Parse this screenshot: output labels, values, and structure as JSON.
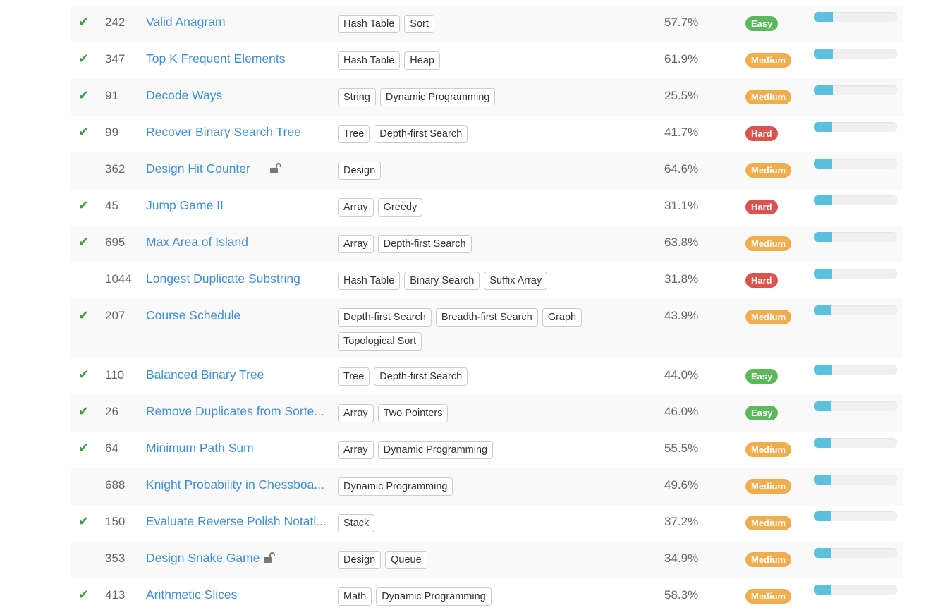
{
  "colors": {
    "easy": "#5cb85c",
    "medium": "#f0ad4e",
    "hard": "#d9534f",
    "check": "#3c9a48",
    "link": "#3f8fd8",
    "progress": "#5bc0de"
  },
  "problems": [
    {
      "solved": true,
      "id": "242",
      "title": "Valid Anagram",
      "locked": false,
      "tags": [
        "Hash Table",
        "Sort"
      ],
      "acceptance": "57.7%",
      "difficulty": "Easy",
      "frequency": 0.23
    },
    {
      "solved": true,
      "id": "347",
      "title": "Top K Frequent Elements",
      "locked": false,
      "tags": [
        "Hash Table",
        "Heap"
      ],
      "acceptance": "61.9%",
      "difficulty": "Medium",
      "frequency": 0.23
    },
    {
      "solved": true,
      "id": "91",
      "title": "Decode Ways",
      "locked": false,
      "tags": [
        "String",
        "Dynamic Programming"
      ],
      "acceptance": "25.5%",
      "difficulty": "Medium",
      "frequency": 0.23
    },
    {
      "solved": true,
      "id": "99",
      "title": "Recover Binary Search Tree",
      "locked": false,
      "tags": [
        "Tree",
        "Depth-first Search"
      ],
      "acceptance": "41.7%",
      "difficulty": "Hard",
      "frequency": 0.22
    },
    {
      "solved": false,
      "id": "362",
      "title": "Design Hit Counter",
      "locked": true,
      "tags": [
        "Design"
      ],
      "acceptance": "64.6%",
      "difficulty": "Medium",
      "frequency": 0.22
    },
    {
      "solved": true,
      "id": "45",
      "title": "Jump Game II",
      "locked": false,
      "tags": [
        "Array",
        "Greedy"
      ],
      "acceptance": "31.1%",
      "difficulty": "Hard",
      "frequency": 0.22
    },
    {
      "solved": true,
      "id": "695",
      "title": "Max Area of Island",
      "locked": false,
      "tags": [
        "Array",
        "Depth-first Search"
      ],
      "acceptance": "63.8%",
      "difficulty": "Medium",
      "frequency": 0.22
    },
    {
      "solved": false,
      "id": "1044",
      "title": "Longest Duplicate Substring",
      "locked": false,
      "tags": [
        "Hash Table",
        "Binary Search",
        "Suffix Array"
      ],
      "acceptance": "31.8%",
      "difficulty": "Hard",
      "frequency": 0.22
    },
    {
      "solved": true,
      "id": "207",
      "title": "Course Schedule",
      "locked": false,
      "tags": [
        "Depth-first Search",
        "Breadth-first Search",
        "Graph",
        "Topological Sort"
      ],
      "acceptance": "43.9%",
      "difficulty": "Medium",
      "frequency": 0.21
    },
    {
      "solved": true,
      "id": "110",
      "title": "Balanced Binary Tree",
      "locked": false,
      "tags": [
        "Tree",
        "Depth-first Search"
      ],
      "acceptance": "44.0%",
      "difficulty": "Easy",
      "frequency": 0.22
    },
    {
      "solved": true,
      "id": "26",
      "title": "Remove Duplicates from Sorte...",
      "locked": false,
      "tags": [
        "Array",
        "Two Pointers"
      ],
      "acceptance": "46.0%",
      "difficulty": "Easy",
      "frequency": 0.21
    },
    {
      "solved": true,
      "id": "64",
      "title": "Minimum Path Sum",
      "locked": false,
      "tags": [
        "Array",
        "Dynamic Programming"
      ],
      "acceptance": "55.5%",
      "difficulty": "Medium",
      "frequency": 0.21
    },
    {
      "solved": false,
      "id": "688",
      "title": "Knight Probability in Chessboa...",
      "locked": false,
      "tags": [
        "Dynamic Programming"
      ],
      "acceptance": "49.6%",
      "difficulty": "Medium",
      "frequency": 0.21
    },
    {
      "solved": true,
      "id": "150",
      "title": "Evaluate Reverse Polish Notati...",
      "locked": false,
      "tags": [
        "Stack"
      ],
      "acceptance": "37.2%",
      "difficulty": "Medium",
      "frequency": 0.21
    },
    {
      "solved": false,
      "id": "353",
      "title": "Design Snake Game",
      "locked": true,
      "tags": [
        "Design",
        "Queue"
      ],
      "acceptance": "34.9%",
      "difficulty": "Medium",
      "frequency": 0.21
    },
    {
      "solved": true,
      "id": "413",
      "title": "Arithmetic Slices",
      "locked": false,
      "tags": [
        "Math",
        "Dynamic Programming"
      ],
      "acceptance": "58.3%",
      "difficulty": "Medium",
      "frequency": 0.21
    }
  ]
}
